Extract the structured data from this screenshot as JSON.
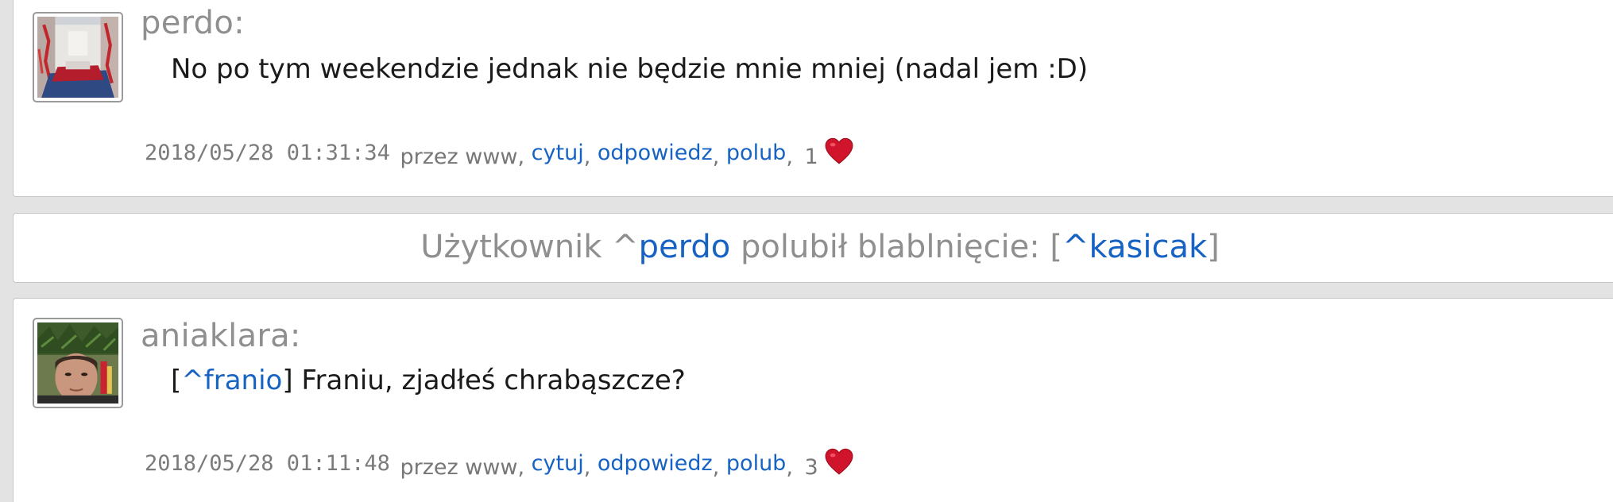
{
  "posts": [
    {
      "author": "perdo:",
      "message": "No po tym weekendzie jednak nie będzie mnie mniej (nadal jem :D)",
      "timestamp": "2018/05/28 01:31:34",
      "via": "przez www",
      "actions": {
        "quote": "cytuj",
        "reply": "odpowiedz",
        "like": "polub"
      },
      "like_count": "1",
      "comma": ","
    },
    {
      "author": "aniaklara:",
      "message_prefix": "[",
      "message_mention": "^franio",
      "message_suffix": "] Franiu, zjadłeś chrabąszcze?",
      "timestamp": "2018/05/28 01:11:48",
      "via": "przez www",
      "actions": {
        "quote": "cytuj",
        "reply": "odpowiedz",
        "like": "polub"
      },
      "like_count": "3",
      "comma": ","
    }
  ],
  "notice": {
    "prefix": "Użytkownik ^",
    "user": "perdo",
    "middle": " polubił blablnięcie: [",
    "target": "^kasicak",
    "suffix": "]"
  },
  "colors": {
    "link": "#1763c4",
    "muted": "#8f8f8f",
    "heart": "#d0142c",
    "background": "#e3e3e3"
  },
  "icons": [
    "heart-icon"
  ]
}
